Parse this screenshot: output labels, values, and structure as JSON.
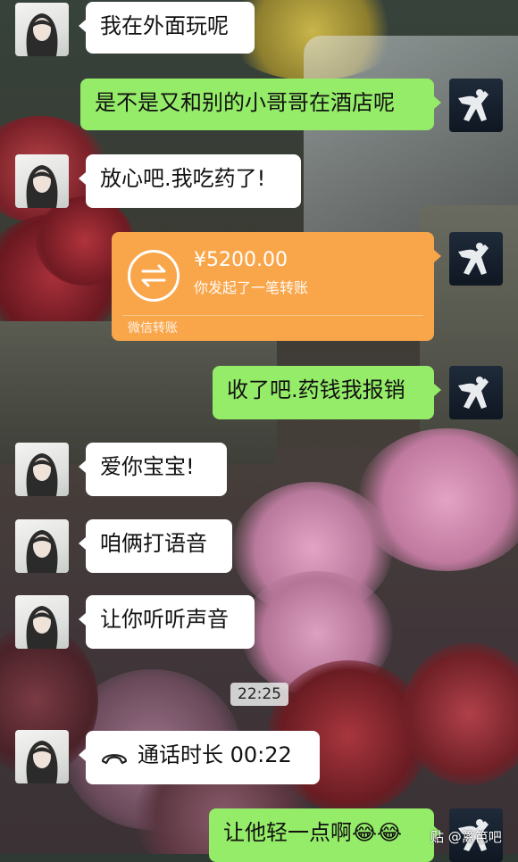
{
  "messages": [
    {
      "text": "我在外面玩呢"
    },
    {
      "text": "是不是又和别的小哥哥在酒店呢"
    },
    {
      "text": "放心吧.我吃药了!"
    },
    {
      "text": "收了吧.药钱我报销"
    },
    {
      "text": "爱你宝宝!"
    },
    {
      "text": "咱俩打语音"
    },
    {
      "text": "让你听听声音"
    },
    {
      "text": "让他轻一点啊😂😂"
    }
  ],
  "transfer": {
    "amount": "¥5200.00",
    "note": "你发起了一笔转账",
    "footer": "微信转账",
    "icon": "exchange-arrows-icon"
  },
  "timestamp": "22:25",
  "call": {
    "label": "通话时长 00:22",
    "icon": "phone-icon"
  },
  "watermark": "贴 @篱笆吧",
  "colors": {
    "outgoing_bubble": "#95ec69",
    "incoming_bubble": "#ffffff",
    "transfer_card": "#f9a64b"
  }
}
